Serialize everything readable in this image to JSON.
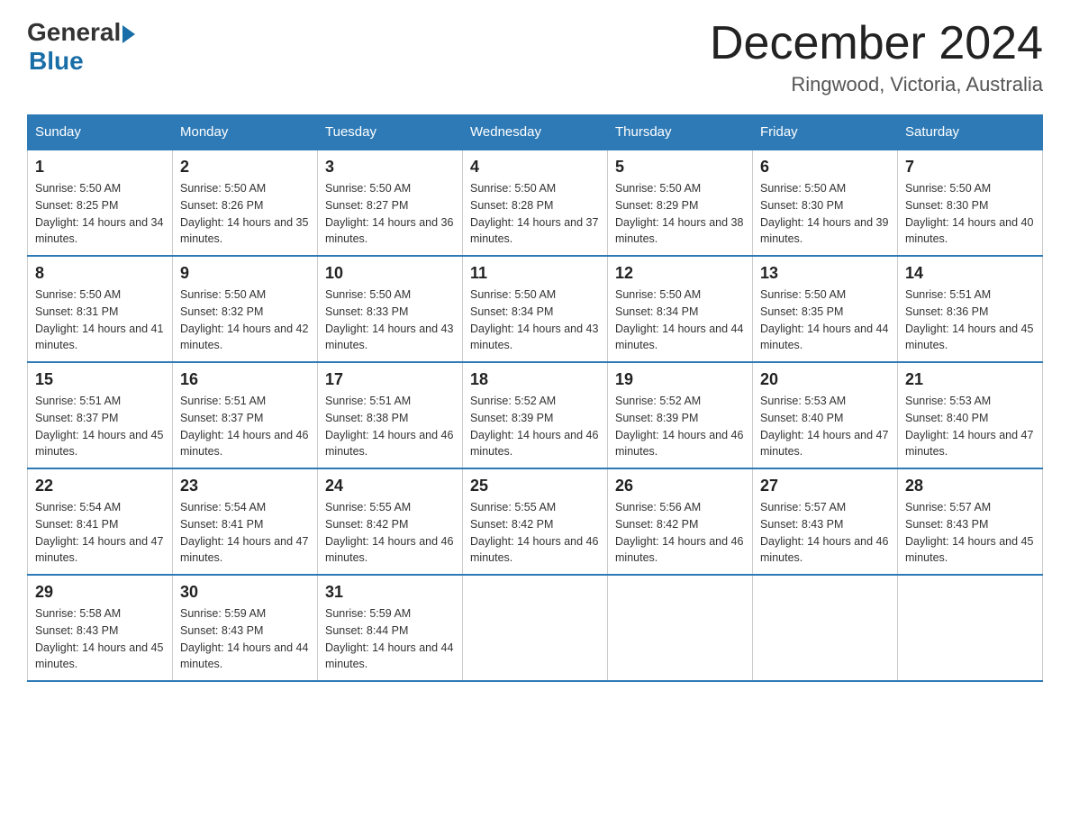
{
  "header": {
    "logo_general": "General",
    "logo_blue": "Blue",
    "title": "December 2024",
    "subtitle": "Ringwood, Victoria, Australia"
  },
  "days_of_week": [
    "Sunday",
    "Monday",
    "Tuesday",
    "Wednesday",
    "Thursday",
    "Friday",
    "Saturday"
  ],
  "weeks": [
    [
      {
        "day": "1",
        "sunrise": "Sunrise: 5:50 AM",
        "sunset": "Sunset: 8:25 PM",
        "daylight": "Daylight: 14 hours and 34 minutes."
      },
      {
        "day": "2",
        "sunrise": "Sunrise: 5:50 AM",
        "sunset": "Sunset: 8:26 PM",
        "daylight": "Daylight: 14 hours and 35 minutes."
      },
      {
        "day": "3",
        "sunrise": "Sunrise: 5:50 AM",
        "sunset": "Sunset: 8:27 PM",
        "daylight": "Daylight: 14 hours and 36 minutes."
      },
      {
        "day": "4",
        "sunrise": "Sunrise: 5:50 AM",
        "sunset": "Sunset: 8:28 PM",
        "daylight": "Daylight: 14 hours and 37 minutes."
      },
      {
        "day": "5",
        "sunrise": "Sunrise: 5:50 AM",
        "sunset": "Sunset: 8:29 PM",
        "daylight": "Daylight: 14 hours and 38 minutes."
      },
      {
        "day": "6",
        "sunrise": "Sunrise: 5:50 AM",
        "sunset": "Sunset: 8:30 PM",
        "daylight": "Daylight: 14 hours and 39 minutes."
      },
      {
        "day": "7",
        "sunrise": "Sunrise: 5:50 AM",
        "sunset": "Sunset: 8:30 PM",
        "daylight": "Daylight: 14 hours and 40 minutes."
      }
    ],
    [
      {
        "day": "8",
        "sunrise": "Sunrise: 5:50 AM",
        "sunset": "Sunset: 8:31 PM",
        "daylight": "Daylight: 14 hours and 41 minutes."
      },
      {
        "day": "9",
        "sunrise": "Sunrise: 5:50 AM",
        "sunset": "Sunset: 8:32 PM",
        "daylight": "Daylight: 14 hours and 42 minutes."
      },
      {
        "day": "10",
        "sunrise": "Sunrise: 5:50 AM",
        "sunset": "Sunset: 8:33 PM",
        "daylight": "Daylight: 14 hours and 43 minutes."
      },
      {
        "day": "11",
        "sunrise": "Sunrise: 5:50 AM",
        "sunset": "Sunset: 8:34 PM",
        "daylight": "Daylight: 14 hours and 43 minutes."
      },
      {
        "day": "12",
        "sunrise": "Sunrise: 5:50 AM",
        "sunset": "Sunset: 8:34 PM",
        "daylight": "Daylight: 14 hours and 44 minutes."
      },
      {
        "day": "13",
        "sunrise": "Sunrise: 5:50 AM",
        "sunset": "Sunset: 8:35 PM",
        "daylight": "Daylight: 14 hours and 44 minutes."
      },
      {
        "day": "14",
        "sunrise": "Sunrise: 5:51 AM",
        "sunset": "Sunset: 8:36 PM",
        "daylight": "Daylight: 14 hours and 45 minutes."
      }
    ],
    [
      {
        "day": "15",
        "sunrise": "Sunrise: 5:51 AM",
        "sunset": "Sunset: 8:37 PM",
        "daylight": "Daylight: 14 hours and 45 minutes."
      },
      {
        "day": "16",
        "sunrise": "Sunrise: 5:51 AM",
        "sunset": "Sunset: 8:37 PM",
        "daylight": "Daylight: 14 hours and 46 minutes."
      },
      {
        "day": "17",
        "sunrise": "Sunrise: 5:51 AM",
        "sunset": "Sunset: 8:38 PM",
        "daylight": "Daylight: 14 hours and 46 minutes."
      },
      {
        "day": "18",
        "sunrise": "Sunrise: 5:52 AM",
        "sunset": "Sunset: 8:39 PM",
        "daylight": "Daylight: 14 hours and 46 minutes."
      },
      {
        "day": "19",
        "sunrise": "Sunrise: 5:52 AM",
        "sunset": "Sunset: 8:39 PM",
        "daylight": "Daylight: 14 hours and 46 minutes."
      },
      {
        "day": "20",
        "sunrise": "Sunrise: 5:53 AM",
        "sunset": "Sunset: 8:40 PM",
        "daylight": "Daylight: 14 hours and 47 minutes."
      },
      {
        "day": "21",
        "sunrise": "Sunrise: 5:53 AM",
        "sunset": "Sunset: 8:40 PM",
        "daylight": "Daylight: 14 hours and 47 minutes."
      }
    ],
    [
      {
        "day": "22",
        "sunrise": "Sunrise: 5:54 AM",
        "sunset": "Sunset: 8:41 PM",
        "daylight": "Daylight: 14 hours and 47 minutes."
      },
      {
        "day": "23",
        "sunrise": "Sunrise: 5:54 AM",
        "sunset": "Sunset: 8:41 PM",
        "daylight": "Daylight: 14 hours and 47 minutes."
      },
      {
        "day": "24",
        "sunrise": "Sunrise: 5:55 AM",
        "sunset": "Sunset: 8:42 PM",
        "daylight": "Daylight: 14 hours and 46 minutes."
      },
      {
        "day": "25",
        "sunrise": "Sunrise: 5:55 AM",
        "sunset": "Sunset: 8:42 PM",
        "daylight": "Daylight: 14 hours and 46 minutes."
      },
      {
        "day": "26",
        "sunrise": "Sunrise: 5:56 AM",
        "sunset": "Sunset: 8:42 PM",
        "daylight": "Daylight: 14 hours and 46 minutes."
      },
      {
        "day": "27",
        "sunrise": "Sunrise: 5:57 AM",
        "sunset": "Sunset: 8:43 PM",
        "daylight": "Daylight: 14 hours and 46 minutes."
      },
      {
        "day": "28",
        "sunrise": "Sunrise: 5:57 AM",
        "sunset": "Sunset: 8:43 PM",
        "daylight": "Daylight: 14 hours and 45 minutes."
      }
    ],
    [
      {
        "day": "29",
        "sunrise": "Sunrise: 5:58 AM",
        "sunset": "Sunset: 8:43 PM",
        "daylight": "Daylight: 14 hours and 45 minutes."
      },
      {
        "day": "30",
        "sunrise": "Sunrise: 5:59 AM",
        "sunset": "Sunset: 8:43 PM",
        "daylight": "Daylight: 14 hours and 44 minutes."
      },
      {
        "day": "31",
        "sunrise": "Sunrise: 5:59 AM",
        "sunset": "Sunset: 8:44 PM",
        "daylight": "Daylight: 14 hours and 44 minutes."
      },
      null,
      null,
      null,
      null
    ]
  ]
}
